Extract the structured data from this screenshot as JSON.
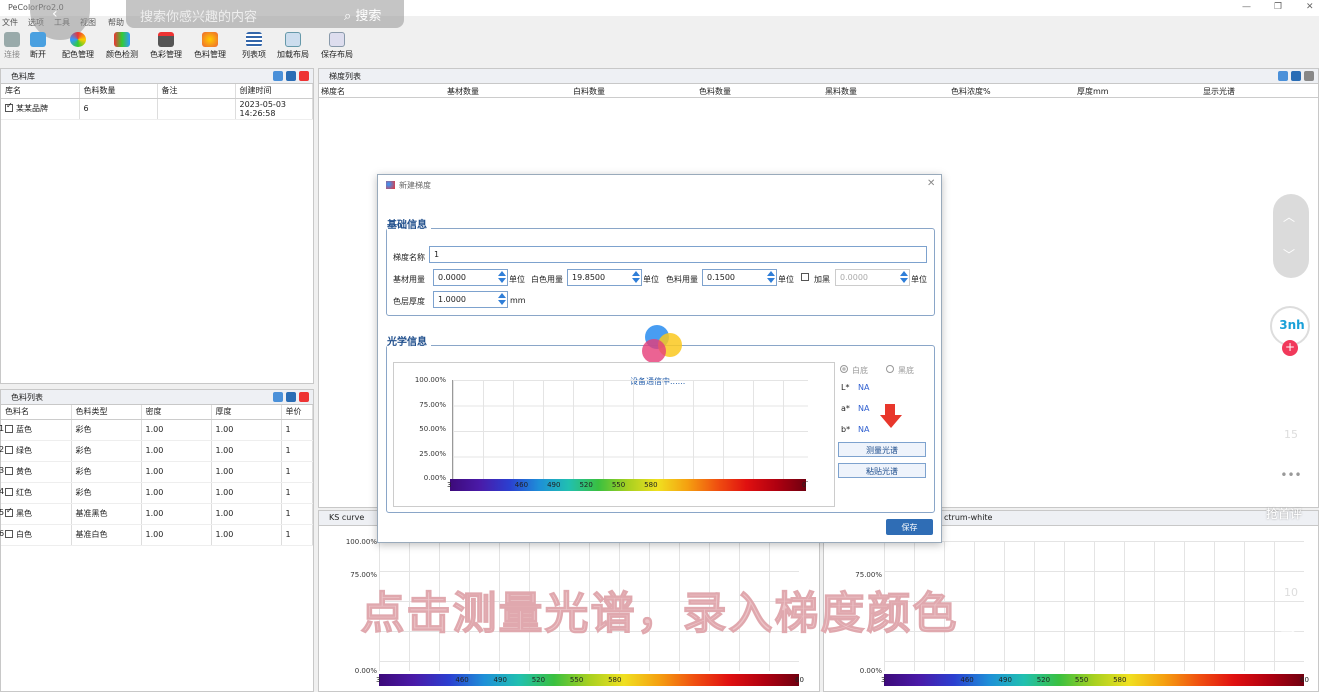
{
  "app": {
    "title": "PeColorPro2.0",
    "menu": [
      "文件",
      "选项",
      "工具",
      "视图",
      "帮助"
    ],
    "window_buttons": [
      "—",
      "❐",
      "✕"
    ]
  },
  "search": {
    "placeholder": "搜索你感兴趣的内容",
    "button": "搜索"
  },
  "toolbar": [
    "连接",
    "断开",
    "配色管理",
    "颜色检测",
    "色彩管理",
    "色料管理",
    "列表项",
    "加载布局",
    "保存布局"
  ],
  "library_panel": {
    "title": "色料库",
    "columns": [
      "库名",
      "色料数量",
      "备注",
      "创建时间"
    ],
    "rows": [
      {
        "name": "某某品牌",
        "count": "6",
        "note": "",
        "created": "2023-05-03 14:26:58",
        "checked": true
      }
    ]
  },
  "material_panel": {
    "title": "色料列表",
    "columns": [
      "色料名",
      "色料类型",
      "密度",
      "厚度",
      "单价"
    ],
    "rows": [
      {
        "idx": "1",
        "name": "蓝色",
        "type": "彩色",
        "density": "1.00",
        "thickness": "1.00",
        "price": "1",
        "checked": false
      },
      {
        "idx": "2",
        "name": "绿色",
        "type": "彩色",
        "density": "1.00",
        "thickness": "1.00",
        "price": "1",
        "checked": false
      },
      {
        "idx": "3",
        "name": "黄色",
        "type": "彩色",
        "density": "1.00",
        "thickness": "1.00",
        "price": "1",
        "checked": false
      },
      {
        "idx": "4",
        "name": "红色",
        "type": "彩色",
        "density": "1.00",
        "thickness": "1.00",
        "price": "1",
        "checked": false
      },
      {
        "idx": "5",
        "name": "黑色",
        "type": "基准黑色",
        "density": "1.00",
        "thickness": "1.00",
        "price": "1",
        "checked": true
      },
      {
        "idx": "6",
        "name": "白色",
        "type": "基准白色",
        "density": "1.00",
        "thickness": "1.00",
        "price": "1",
        "checked": false
      }
    ]
  },
  "gradient_panel": {
    "title": "梯度列表",
    "columns": [
      "梯度名",
      "基材数量",
      "白料数量",
      "色料数量",
      "黑料数量",
      "色料浓度%",
      "厚度mm",
      "显示光谱"
    ]
  },
  "ks_panel": {
    "title": "KS curve"
  },
  "spectrum_panel": {
    "title": "ctrum-white"
  },
  "dialog": {
    "title": "新建梯度",
    "basic": {
      "title": "基础信息",
      "name_label": "梯度名称",
      "name_value": "1",
      "substrate_label": "基材用量",
      "substrate_value": "0.0000",
      "white_label": "白色用量",
      "white_value": "19.8500",
      "color_label": "色料用量",
      "color_value": "0.1500",
      "black_label": "加黑",
      "black_value": "0.0000",
      "unit": "单位",
      "thickness_label": "色层厚度",
      "thickness_value": "1.0000",
      "thickness_unit": "mm"
    },
    "optical": {
      "title": "光学信息",
      "status": "设备通信中......",
      "y_ticks": [
        "100.00%",
        "75.00%",
        "50.00%",
        "25.00%",
        "0.00%"
      ],
      "wavelengths": [
        "3",
        "460",
        "490",
        "520",
        "550",
        "580",
        "0"
      ],
      "radio_white": "白底",
      "radio_black": "黑底",
      "lab": [
        {
          "k": "L*",
          "v": "NA"
        },
        {
          "k": "a*",
          "v": "NA"
        },
        {
          "k": "b*",
          "v": "NA"
        }
      ],
      "measure_btn": "测量光谱",
      "paste_btn": "粘贴光谱"
    },
    "save": "保存"
  },
  "bottom_charts": {
    "left_ticks": [
      "100.00%",
      "75.00%",
      "0.00%"
    ],
    "right_ticks": [
      "75.00%",
      "0.00%"
    ],
    "wavelengths": [
      "3",
      "460",
      "490",
      "520",
      "550",
      "580",
      "60"
    ]
  },
  "caption": "点击测量光谱，录入梯度颜色",
  "side_overlay": {
    "avatar": "3nh",
    "likes": "15",
    "comment": "抢首评",
    "favorites": "10"
  },
  "colors": {
    "accent": "#2f7ed8",
    "group_title": "#1f4e8c",
    "caption": "#ecc4c8",
    "arrow": "#e8372c"
  }
}
